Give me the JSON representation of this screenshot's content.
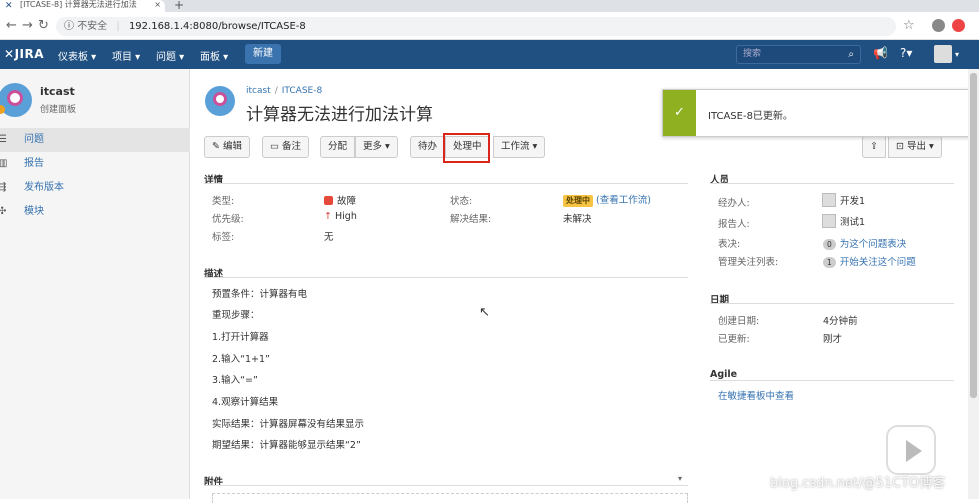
{
  "browser": {
    "tab_title": "[ITCASE-8] 计算器无法进行加法",
    "new_tab": "+",
    "insecure": "不安全",
    "url": "192.168.1.4:8080/browse/ITCASE-8"
  },
  "nav": {
    "logo": "JIRA",
    "menus": [
      "仪表板 ▾",
      "项目 ▾",
      "问题 ▾",
      "面板 ▾"
    ],
    "create": "新建",
    "search_placeholder": "搜索"
  },
  "sidebar": {
    "project_name": "itcast",
    "project_sub": "创建面板",
    "items": [
      {
        "label": "问题",
        "icon": "issues-icon"
      },
      {
        "label": "报告",
        "icon": "reports-icon"
      },
      {
        "label": "发布版本",
        "icon": "releases-icon"
      },
      {
        "label": "模块",
        "icon": "components-icon"
      }
    ]
  },
  "issue": {
    "breadcrumb_project": "itcast",
    "breadcrumb_sep": "/",
    "breadcrumb_key": "ITCASE-8",
    "title": "计算器无法进行加法计算"
  },
  "toolbar": {
    "edit": "编辑",
    "comment": "备注",
    "assign": "分配",
    "more": "更多 ▾",
    "todo": "待办",
    "in_progress": "处理中",
    "workflow": "工作流 ▾",
    "share": "⇪",
    "export": "导出 ▾"
  },
  "details": {
    "header": "详情",
    "type_label": "类型:",
    "type_value": "故障",
    "priority_label": "优先级:",
    "priority_value": "High",
    "labels_label": "标签:",
    "labels_value": "无",
    "status_label": "状态:",
    "status_value": "处理中",
    "status_link": "(查看工作流)",
    "resolution_label": "解决结果:",
    "resolution_value": "未解决"
  },
  "description": {
    "header": "描述",
    "lines": [
      "预置条件：计算器有电",
      "重现步骤：",
      "1.打开计算器",
      "2.输入“1+1”",
      "3.输入“=”",
      "4.观察计算结果",
      "实际结果：计算器屏幕没有结果显示",
      "期望结果：计算器能够显示结果“2”"
    ]
  },
  "attachments": {
    "header": "附件"
  },
  "people": {
    "header": "人员",
    "assignee_label": "经办人:",
    "assignee": "开发1",
    "reporter_label": "报告人:",
    "reporter": "测试1",
    "votes_label": "表决:",
    "votes_count": "0",
    "votes_link": "为这个问题表决",
    "watchers_label": "管理关注列表:",
    "watchers_count": "1",
    "watchers_link": "开始关注这个问题"
  },
  "dates": {
    "header": "日期",
    "created_label": "创建日期:",
    "created": "4分钟前",
    "updated_label": "已更新:",
    "updated": "刚才"
  },
  "agile": {
    "header": "Agile",
    "link": "在敏捷看板中查看"
  },
  "toast": {
    "icon": "✓",
    "message": "ITCASE-8已更新。"
  },
  "watermark": "blog.csdn.net/@51CTO博客",
  "colors": {
    "header_bg": "#205081",
    "link": "#3572b0",
    "success": "#8eb021",
    "status_lozenge": "#f6c342",
    "highlight": "#d9261c"
  }
}
